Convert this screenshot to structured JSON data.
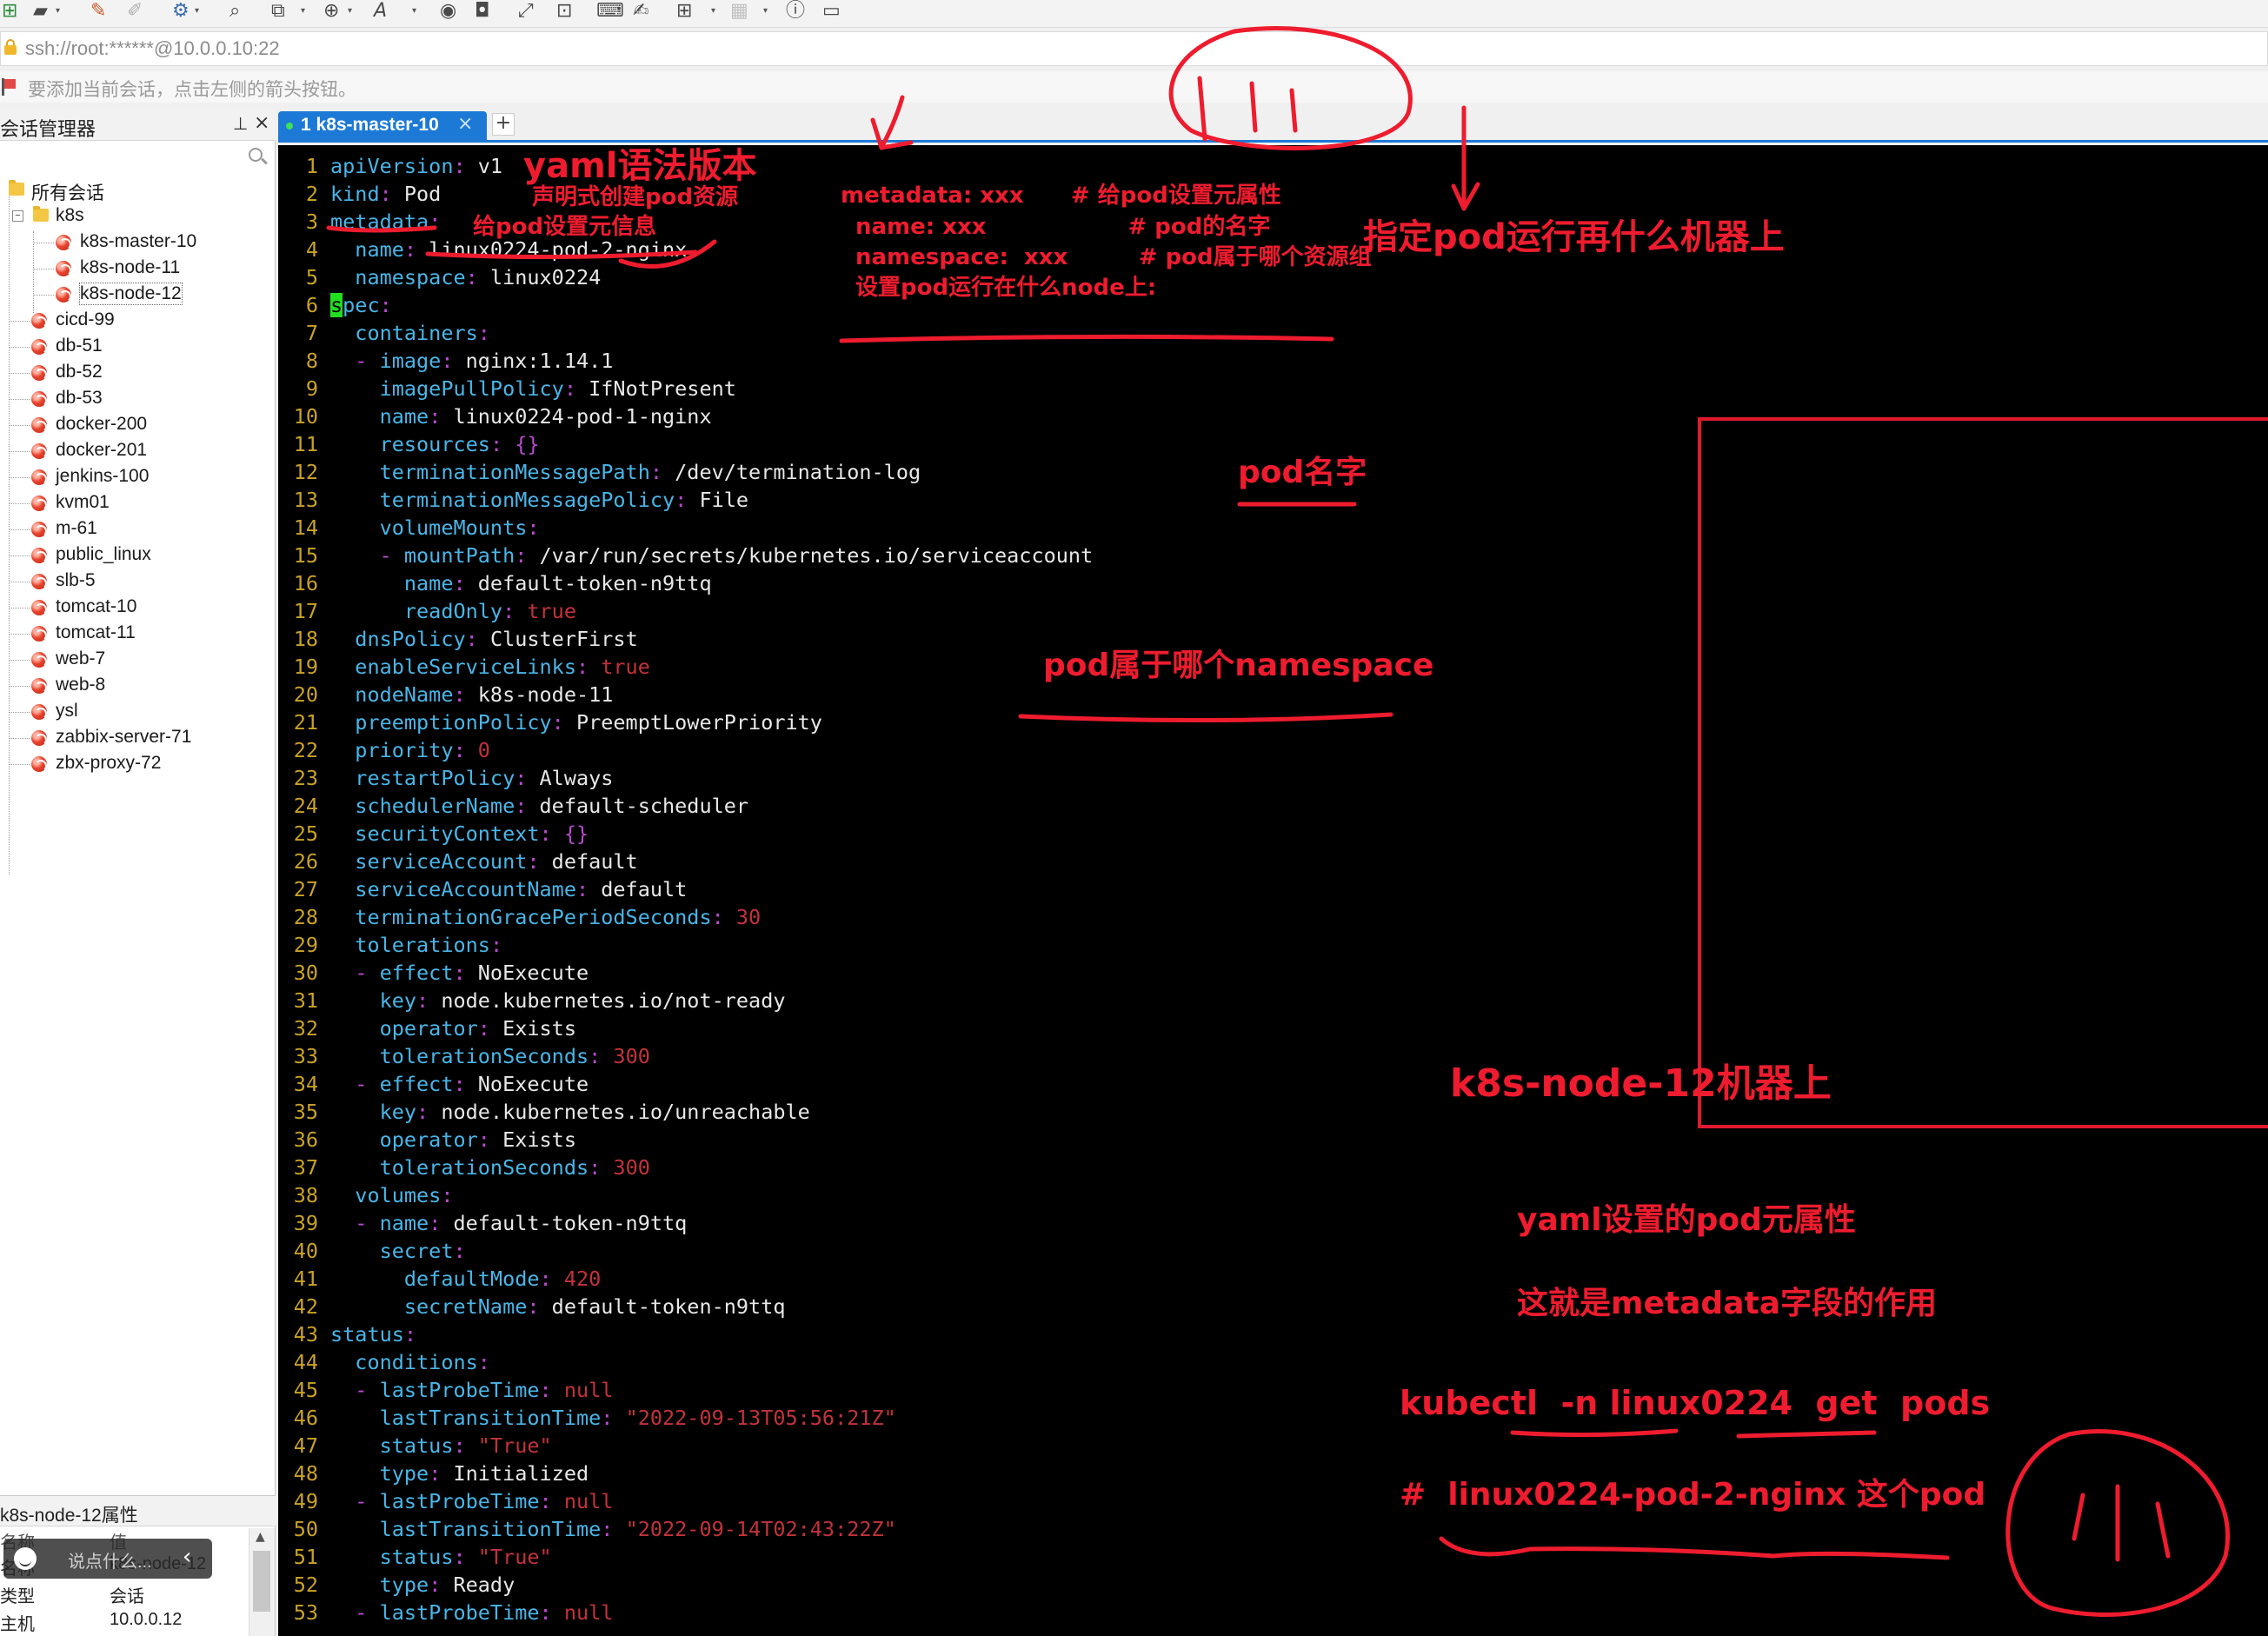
{
  "toolbar": {
    "icons": [
      "new-session-icon",
      "open-folder-icon",
      "edit-icon",
      "brush-icon",
      "settings-icon",
      "search-icon",
      "transfer-icon",
      "globe-icon",
      "font-icon",
      "scripts-icon",
      "record-icon",
      "fullscreen-icon",
      "lock-icon",
      "keyboard-icon",
      "compose-icon",
      "add-icon",
      "layout-icon",
      "help-icon",
      "chat-icon"
    ]
  },
  "address": {
    "text": "ssh://root:******@10.0.0.10:22"
  },
  "hint": {
    "text": "要添加当前会话，点击左侧的箭头按钮。"
  },
  "session_manager": {
    "title": "会话管理器",
    "root": "所有会话",
    "group": "k8s",
    "group_items": [
      "k8s-master-10",
      "k8s-node-11",
      "k8s-node-12"
    ],
    "items": [
      "cicd-99",
      "db-51",
      "db-52",
      "db-53",
      "docker-200",
      "docker-201",
      "jenkins-100",
      "kvm01",
      "m-61",
      "public_linux",
      "slb-5",
      "tomcat-10",
      "tomcat-11",
      "web-7",
      "web-8",
      "ysl",
      "zabbix-server-71",
      "zbx-proxy-72"
    ]
  },
  "properties": {
    "title": "k8s-node-12属性",
    "col_name": "名称",
    "col_value": "值",
    "rows": [
      {
        "name": "名称",
        "value": "k8s-node-12"
      },
      {
        "name": "类型",
        "value": "会话"
      },
      {
        "name": "主机",
        "value": "10.0.0.12"
      }
    ]
  },
  "chat": {
    "placeholder": "说点什么..."
  },
  "tab": {
    "label": "1 k8s-master-10"
  },
  "colors": {
    "key": "#49b6e8",
    "value": "#e8e8e8",
    "string": "#c4323a",
    "punct": "#b94ad0",
    "linenum": "#c9a227",
    "annotation": "#ee1c2e",
    "tab": "#1c7ad6"
  },
  "yaml": [
    {
      "n": "1",
      "parts": [
        [
          "k",
          "apiVersion"
        ],
        [
          "p",
          ": "
        ],
        [
          "n",
          "v1"
        ]
      ]
    },
    {
      "n": "2",
      "parts": [
        [
          "k",
          "kind"
        ],
        [
          "p",
          ": "
        ],
        [
          "n",
          "Pod"
        ]
      ]
    },
    {
      "n": "3",
      "parts": [
        [
          "k",
          "metadata"
        ],
        [
          "p",
          ":"
        ]
      ]
    },
    {
      "n": "4",
      "parts": [
        [
          "n",
          "  "
        ],
        [
          "k",
          "name"
        ],
        [
          "p",
          ": "
        ],
        [
          "n",
          "linux0224-pod-2-nginx"
        ]
      ]
    },
    {
      "n": "5",
      "parts": [
        [
          "n",
          "  "
        ],
        [
          "k",
          "namespace"
        ],
        [
          "p",
          ": "
        ],
        [
          "n",
          "linux0224"
        ]
      ]
    },
    {
      "n": "6",
      "parts": [
        [
          "c",
          "s"
        ],
        [
          "k",
          "pec"
        ],
        [
          "p",
          ":"
        ]
      ]
    },
    {
      "n": "7",
      "parts": [
        [
          "n",
          "  "
        ],
        [
          "k",
          "containers"
        ],
        [
          "p",
          ":"
        ]
      ]
    },
    {
      "n": "8",
      "parts": [
        [
          "n",
          "  "
        ],
        [
          "p",
          "- "
        ],
        [
          "k",
          "image"
        ],
        [
          "p",
          ": "
        ],
        [
          "n",
          "nginx:1.14.1"
        ]
      ]
    },
    {
      "n": "9",
      "parts": [
        [
          "n",
          "    "
        ],
        [
          "k",
          "imagePullPolicy"
        ],
        [
          "p",
          ": "
        ],
        [
          "n",
          "IfNotPresent"
        ]
      ]
    },
    {
      "n": "10",
      "parts": [
        [
          "n",
          "    "
        ],
        [
          "k",
          "name"
        ],
        [
          "p",
          ": "
        ],
        [
          "n",
          "linux0224-pod-1-nginx"
        ]
      ]
    },
    {
      "n": "11",
      "parts": [
        [
          "n",
          "    "
        ],
        [
          "k",
          "resources"
        ],
        [
          "p",
          ": {}"
        ]
      ]
    },
    {
      "n": "12",
      "parts": [
        [
          "n",
          "    "
        ],
        [
          "k",
          "terminationMessagePath"
        ],
        [
          "p",
          ": "
        ],
        [
          "n",
          "/dev/termination-log"
        ]
      ]
    },
    {
      "n": "13",
      "parts": [
        [
          "n",
          "    "
        ],
        [
          "k",
          "terminationMessagePolicy"
        ],
        [
          "p",
          ": "
        ],
        [
          "n",
          "File"
        ]
      ]
    },
    {
      "n": "14",
      "parts": [
        [
          "n",
          "    "
        ],
        [
          "k",
          "volumeMounts"
        ],
        [
          "p",
          ":"
        ]
      ]
    },
    {
      "n": "15",
      "parts": [
        [
          "n",
          "    "
        ],
        [
          "p",
          "- "
        ],
        [
          "k",
          "mountPath"
        ],
        [
          "p",
          ": "
        ],
        [
          "n",
          "/var/run/secrets/kubernetes.io/serviceaccount"
        ]
      ]
    },
    {
      "n": "16",
      "parts": [
        [
          "n",
          "      "
        ],
        [
          "k",
          "name"
        ],
        [
          "p",
          ": "
        ],
        [
          "n",
          "default-token-n9ttq"
        ]
      ]
    },
    {
      "n": "17",
      "parts": [
        [
          "n",
          "      "
        ],
        [
          "k",
          "readOnly"
        ],
        [
          "p",
          ": "
        ],
        [
          "s",
          "true"
        ]
      ]
    },
    {
      "n": "18",
      "parts": [
        [
          "n",
          "  "
        ],
        [
          "k",
          "dnsPolicy"
        ],
        [
          "p",
          ": "
        ],
        [
          "n",
          "ClusterFirst"
        ]
      ]
    },
    {
      "n": "19",
      "parts": [
        [
          "n",
          "  "
        ],
        [
          "k",
          "enableServiceLinks"
        ],
        [
          "p",
          ": "
        ],
        [
          "s",
          "true"
        ]
      ]
    },
    {
      "n": "20",
      "parts": [
        [
          "n",
          "  "
        ],
        [
          "k",
          "nodeName"
        ],
        [
          "p",
          ": "
        ],
        [
          "n",
          "k8s-node-11"
        ]
      ]
    },
    {
      "n": "21",
      "parts": [
        [
          "n",
          "  "
        ],
        [
          "k",
          "preemptionPolicy"
        ],
        [
          "p",
          ": "
        ],
        [
          "n",
          "PreemptLowerPriority"
        ]
      ]
    },
    {
      "n": "22",
      "parts": [
        [
          "n",
          "  "
        ],
        [
          "k",
          "priority"
        ],
        [
          "p",
          ": "
        ],
        [
          "s",
          "0"
        ]
      ]
    },
    {
      "n": "23",
      "parts": [
        [
          "n",
          "  "
        ],
        [
          "k",
          "restartPolicy"
        ],
        [
          "p",
          ": "
        ],
        [
          "n",
          "Always"
        ]
      ]
    },
    {
      "n": "24",
      "parts": [
        [
          "n",
          "  "
        ],
        [
          "k",
          "schedulerName"
        ],
        [
          "p",
          ": "
        ],
        [
          "n",
          "default-scheduler"
        ]
      ]
    },
    {
      "n": "25",
      "parts": [
        [
          "n",
          "  "
        ],
        [
          "k",
          "securityContext"
        ],
        [
          "p",
          ": {}"
        ]
      ]
    },
    {
      "n": "26",
      "parts": [
        [
          "n",
          "  "
        ],
        [
          "k",
          "serviceAccount"
        ],
        [
          "p",
          ": "
        ],
        [
          "n",
          "default"
        ]
      ]
    },
    {
      "n": "27",
      "parts": [
        [
          "n",
          "  "
        ],
        [
          "k",
          "serviceAccountName"
        ],
        [
          "p",
          ": "
        ],
        [
          "n",
          "default"
        ]
      ]
    },
    {
      "n": "28",
      "parts": [
        [
          "n",
          "  "
        ],
        [
          "k",
          "terminationGracePeriodSeconds"
        ],
        [
          "p",
          ": "
        ],
        [
          "s",
          "30"
        ]
      ]
    },
    {
      "n": "29",
      "parts": [
        [
          "n",
          "  "
        ],
        [
          "k",
          "tolerations"
        ],
        [
          "p",
          ":"
        ]
      ]
    },
    {
      "n": "30",
      "parts": [
        [
          "n",
          "  "
        ],
        [
          "p",
          "- "
        ],
        [
          "k",
          "effect"
        ],
        [
          "p",
          ": "
        ],
        [
          "n",
          "NoExecute"
        ]
      ]
    },
    {
      "n": "31",
      "parts": [
        [
          "n",
          "    "
        ],
        [
          "k",
          "key"
        ],
        [
          "p",
          ": "
        ],
        [
          "n",
          "node.kubernetes.io/not-ready"
        ]
      ]
    },
    {
      "n": "32",
      "parts": [
        [
          "n",
          "    "
        ],
        [
          "k",
          "operator"
        ],
        [
          "p",
          ": "
        ],
        [
          "n",
          "Exists"
        ]
      ]
    },
    {
      "n": "33",
      "parts": [
        [
          "n",
          "    "
        ],
        [
          "k",
          "tolerationSeconds"
        ],
        [
          "p",
          ": "
        ],
        [
          "s",
          "300"
        ]
      ]
    },
    {
      "n": "34",
      "parts": [
        [
          "n",
          "  "
        ],
        [
          "p",
          "- "
        ],
        [
          "k",
          "effect"
        ],
        [
          "p",
          ": "
        ],
        [
          "n",
          "NoExecute"
        ]
      ]
    },
    {
      "n": "35",
      "parts": [
        [
          "n",
          "    "
        ],
        [
          "k",
          "key"
        ],
        [
          "p",
          ": "
        ],
        [
          "n",
          "node.kubernetes.io/unreachable"
        ]
      ]
    },
    {
      "n": "36",
      "parts": [
        [
          "n",
          "    "
        ],
        [
          "k",
          "operator"
        ],
        [
          "p",
          ": "
        ],
        [
          "n",
          "Exists"
        ]
      ]
    },
    {
      "n": "37",
      "parts": [
        [
          "n",
          "    "
        ],
        [
          "k",
          "tolerationSeconds"
        ],
        [
          "p",
          ": "
        ],
        [
          "s",
          "300"
        ]
      ]
    },
    {
      "n": "38",
      "parts": [
        [
          "n",
          "  "
        ],
        [
          "k",
          "volumes"
        ],
        [
          "p",
          ":"
        ]
      ]
    },
    {
      "n": "39",
      "parts": [
        [
          "n",
          "  "
        ],
        [
          "p",
          "- "
        ],
        [
          "k",
          "name"
        ],
        [
          "p",
          ": "
        ],
        [
          "n",
          "default-token-n9ttq"
        ]
      ]
    },
    {
      "n": "40",
      "parts": [
        [
          "n",
          "    "
        ],
        [
          "k",
          "secret"
        ],
        [
          "p",
          ":"
        ]
      ]
    },
    {
      "n": "41",
      "parts": [
        [
          "n",
          "      "
        ],
        [
          "k",
          "defaultMode"
        ],
        [
          "p",
          ": "
        ],
        [
          "s",
          "420"
        ]
      ]
    },
    {
      "n": "42",
      "parts": [
        [
          "n",
          "      "
        ],
        [
          "k",
          "secretName"
        ],
        [
          "p",
          ": "
        ],
        [
          "n",
          "default-token-n9ttq"
        ]
      ]
    },
    {
      "n": "43",
      "parts": [
        [
          "k",
          "status"
        ],
        [
          "p",
          ":"
        ]
      ]
    },
    {
      "n": "44",
      "parts": [
        [
          "n",
          "  "
        ],
        [
          "k",
          "conditions"
        ],
        [
          "p",
          ":"
        ]
      ]
    },
    {
      "n": "45",
      "parts": [
        [
          "n",
          "  "
        ],
        [
          "p",
          "- "
        ],
        [
          "k",
          "lastProbeTime"
        ],
        [
          "p",
          ": "
        ],
        [
          "s",
          "null"
        ]
      ]
    },
    {
      "n": "46",
      "parts": [
        [
          "n",
          "    "
        ],
        [
          "k",
          "lastTransitionTime"
        ],
        [
          "p",
          ": "
        ],
        [
          "s",
          "\"2022-09-13T05:56:21Z\""
        ]
      ]
    },
    {
      "n": "47",
      "parts": [
        [
          "n",
          "    "
        ],
        [
          "k",
          "status"
        ],
        [
          "p",
          ": "
        ],
        [
          "s",
          "\"True\""
        ]
      ]
    },
    {
      "n": "48",
      "parts": [
        [
          "n",
          "    "
        ],
        [
          "k",
          "type"
        ],
        [
          "p",
          ": "
        ],
        [
          "n",
          "Initialized"
        ]
      ]
    },
    {
      "n": "49",
      "parts": [
        [
          "n",
          "  "
        ],
        [
          "p",
          "- "
        ],
        [
          "k",
          "lastProbeTime"
        ],
        [
          "p",
          ": "
        ],
        [
          "s",
          "null"
        ]
      ]
    },
    {
      "n": "50",
      "parts": [
        [
          "n",
          "    "
        ],
        [
          "k",
          "lastTransitionTime"
        ],
        [
          "p",
          ": "
        ],
        [
          "s",
          "\"2022-09-14T02:43:22Z\""
        ]
      ]
    },
    {
      "n": "51",
      "parts": [
        [
          "n",
          "    "
        ],
        [
          "k",
          "status"
        ],
        [
          "p",
          ": "
        ],
        [
          "s",
          "\"True\""
        ]
      ]
    },
    {
      "n": "52",
      "parts": [
        [
          "n",
          "    "
        ],
        [
          "k",
          "type"
        ],
        [
          "p",
          ": "
        ],
        [
          "n",
          "Ready"
        ]
      ]
    },
    {
      "n": "53",
      "parts": [
        [
          "n",
          "  "
        ],
        [
          "p",
          "- "
        ],
        [
          "k",
          "lastProbeTime"
        ],
        [
          "p",
          ": "
        ],
        [
          "s",
          "null"
        ]
      ]
    }
  ],
  "annotations": {
    "yaml_version": "yaml语法版本",
    "declarative": "声明式创建pod资源",
    "metadata_info": "给pod设置元信息",
    "meta_block": [
      "metadata: xxx      # 给pod设置元属性",
      "name: xxx                  # pod的名字",
      "namespace:  xxx         # pod属于哪个资源组",
      "设置pod运行在什么node上:"
    ],
    "node_where": "指定pod运行再什么机器上",
    "pod_name": "pod名字",
    "pod_ns": "pod属于哪个namespace",
    "node12": "k8s-node-12机器上",
    "meta_props": "yaml设置的pod元属性",
    "meta_role": "这就是metadata字段的作用",
    "cmd": "kubectl  -n linux0224  get  pods",
    "this_pod": "#  linux0224-pod-2-nginx 这个pod",
    "scribble_top": "( | | )",
    "scribble_bottom": "( | | )"
  }
}
